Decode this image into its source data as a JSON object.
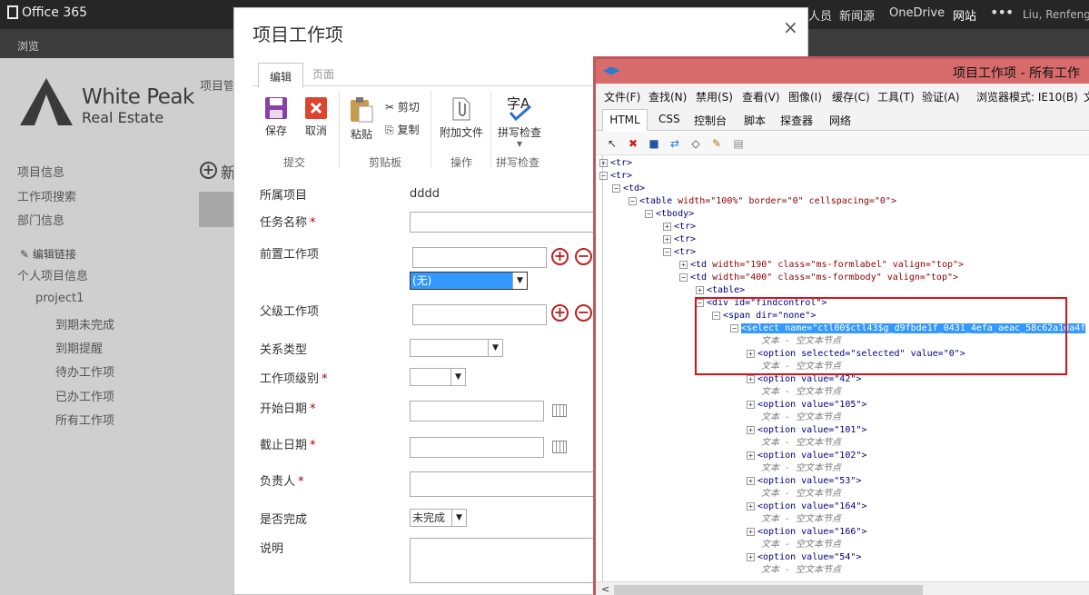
{
  "suite": {
    "app": "Office 365",
    "nav": [
      "人员",
      "新闻源",
      "OneDrive",
      "网站"
    ],
    "more": "•••",
    "user": "Liu, Renfeng"
  },
  "browse": "浏览",
  "brand": {
    "line1": "White Peak",
    "line2": "Real Estate"
  },
  "breadcrumb": "项目管",
  "new_label": "新",
  "left_nav": {
    "items": [
      "项目信息",
      "工作项搜索",
      "部门信息"
    ],
    "edit_links": "编辑链接",
    "personal": "个人项目信息",
    "project": "project1",
    "sub": [
      "到期未完成",
      "到期提醒",
      "待办工作项",
      "已办工作项",
      "所有工作项"
    ]
  },
  "dialog": {
    "title": "项目工作项",
    "close": "×",
    "tabs": [
      "编辑",
      "页面"
    ],
    "ribbon": {
      "save": "保存",
      "cancel": "取消",
      "paste": "粘贴",
      "cut": "剪切",
      "copy": "复制",
      "attach": "附加文件",
      "spell": "拼写检查",
      "groups": [
        "提交",
        "剪贴板",
        "操作",
        "拼写检查"
      ]
    },
    "form": {
      "project_label": "所属项目",
      "project_value": "dddd",
      "task_name": "任务名称",
      "predecessor": "前置工作项",
      "predecessor_select": "(无)",
      "parent": "父级工作项",
      "relation": "关系类型",
      "level": "工作项级别",
      "start": "开始日期",
      "end": "截止日期",
      "owner": "负责人",
      "done": "是否完成",
      "done_value": "未完成",
      "desc": "说明",
      "required_mark": "*"
    }
  },
  "devtools": {
    "title": "项目工作项 - 所有工作",
    "menu": [
      "文件(F)",
      "查找(N)",
      "禁用(S)",
      "查看(V)",
      "图像(I)",
      "缓存(C)",
      "工具(T)",
      "验证(A)",
      "浏览器模式: IE10(B)",
      "文"
    ],
    "tabs": [
      "HTML",
      "CSS",
      "控制台",
      "脚本",
      "探查器",
      "网络"
    ],
    "tree": {
      "tr": "<tr>",
      "td": "<td>",
      "table_open": "<table",
      "table_attrs": "width=\"100%\" border=\"0\" cellspacing=\"0\">",
      "tbody": "<tbody>",
      "td190_tag": "<td",
      "td190_attrs": "width=\"190\" class=\"ms-formlabel\" valign=\"top\">",
      "td400_attrs": "width=\"400\" class=\"ms-formbody\" valign=\"top\">",
      "table": "<table>",
      "div": "<div id=\"findcontrol\">",
      "span": "<span dir=\"none\">",
      "select": "<select name=\"ctl00$ctl43$g_d9fbde1f_0431_4efa_aeac_58c62a1da4f",
      "empty_text": "文本 - 空文本节点",
      "option_selected": "<option selected=\"selected\" value=\"0\">",
      "options": [
        "<option value=\"42\">",
        "<option value=\"105\">",
        "<option value=\"101\">",
        "<option value=\"102\">",
        "<option value=\"53\">",
        "<option value=\"164\">",
        "<option value=\"166\">",
        "<option value=\"54\">"
      ]
    },
    "scroll_left": "<"
  }
}
